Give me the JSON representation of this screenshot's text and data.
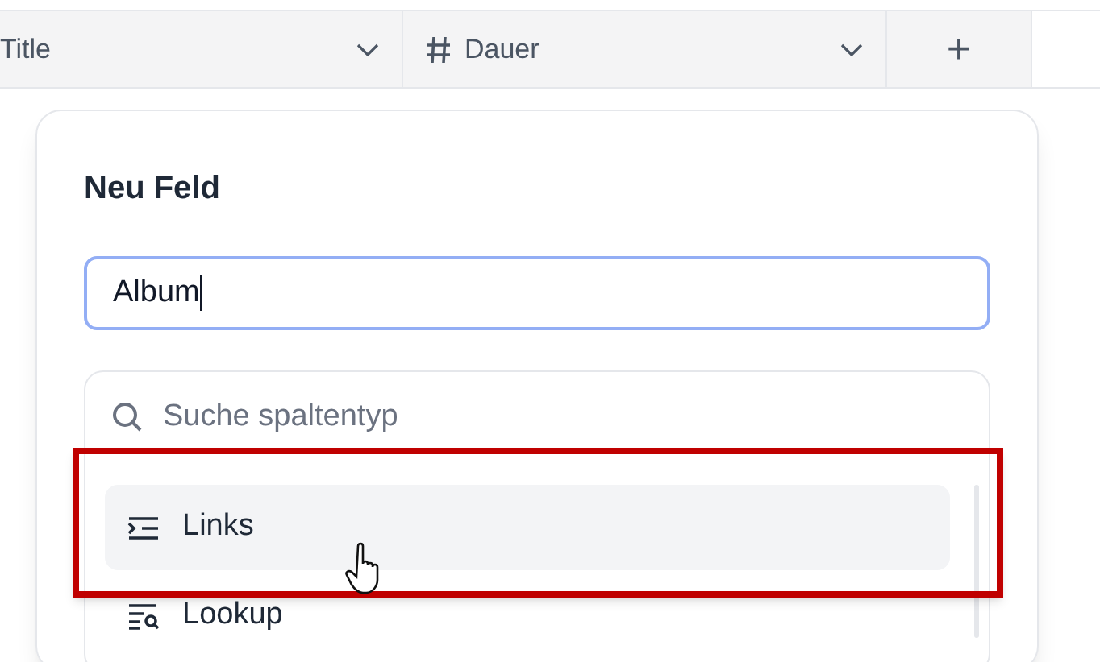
{
  "columns": [
    {
      "kind": "text",
      "label": "Title"
    },
    {
      "kind": "number",
      "label": "Dauer"
    }
  ],
  "add_column": "+",
  "dialog": {
    "title": "Neu Feld",
    "field_value": "Album",
    "type_search": {
      "placeholder": "Suche spaltentyp"
    },
    "types": [
      {
        "kind": "links",
        "label": "Links",
        "selected": true
      },
      {
        "kind": "lookup",
        "label": "Lookup",
        "selected": false
      }
    ]
  }
}
